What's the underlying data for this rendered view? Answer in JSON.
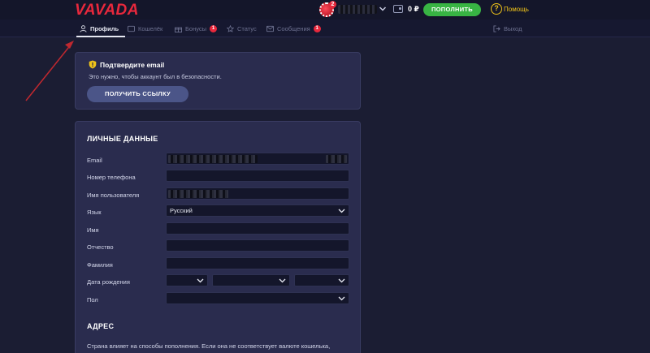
{
  "header": {
    "logo": "VAVADA",
    "avatar_badge": "2",
    "balance": "0 ₽",
    "deposit_label": "ПОПОЛНИТЬ",
    "help_label": "Помощь",
    "help_symbol": "?"
  },
  "tabs": [
    {
      "label": "Профиль",
      "icon": "user-icon",
      "active": true
    },
    {
      "label": "Кошелёк",
      "icon": "wallet-icon",
      "active": false
    },
    {
      "label": "Бонусы",
      "icon": "gift-icon",
      "badge": "1",
      "active": false
    },
    {
      "label": "Статус",
      "icon": "star-icon",
      "active": false
    },
    {
      "label": "Сообщения",
      "icon": "mail-icon",
      "badge": "1",
      "active": false
    },
    {
      "label": "Выход",
      "icon": "logout-icon",
      "active": false
    }
  ],
  "verify": {
    "title": "Подтвердите email",
    "text": "Это нужно, чтобы аккаунт был в безопасности.",
    "button_label": "ПОЛУЧИТЬ ССЫЛКУ"
  },
  "personal": {
    "title": "ЛИЧНЫЕ ДАННЫЕ",
    "fields": [
      {
        "label": "Email",
        "value": ""
      },
      {
        "label": "Номер телефона",
        "value": ""
      },
      {
        "label": "Имя пользователя",
        "value": ""
      },
      {
        "label": "Язык",
        "value": "Русский"
      },
      {
        "label": "Имя",
        "value": ""
      },
      {
        "label": "Отчество",
        "value": ""
      },
      {
        "label": "Фамилия",
        "value": ""
      },
      {
        "label": "Дата рождения",
        "value": ""
      },
      {
        "label": "Пол",
        "value": ""
      }
    ]
  },
  "address": {
    "title": "АДРЕС",
    "text": "Страна влияет на способы пополнения. Если она не соответствует валюте кошелька, возможные способы могут быть недоступны."
  },
  "colors": {
    "accent_red": "#e8283c",
    "deposit_green": "#38b443",
    "help_yellow": "#f0c419",
    "button_blue": "#4b5588",
    "annotation_arrow": "#c0282f"
  }
}
